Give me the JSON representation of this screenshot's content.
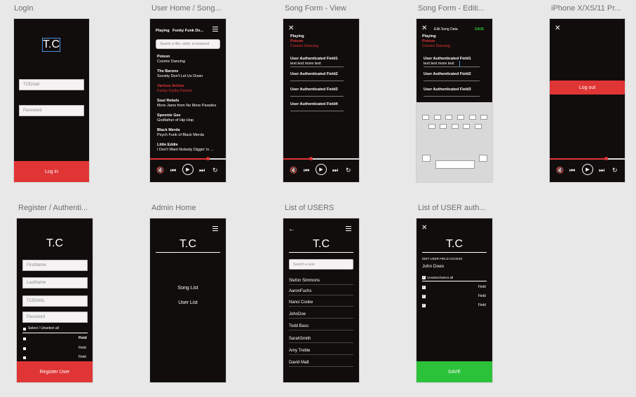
{
  "artboards": {
    "login": {
      "title": "LogIn",
      "logo": "T.C",
      "email_placeholder": "TCEmail",
      "password_placeholder": "Password",
      "login_button": "Log in"
    },
    "user_home": {
      "title": "User Home / Song...",
      "header_playing": "Playing",
      "header_song": "Funky Funk De...",
      "search_placeholder": "Search a title, artist, or keyword",
      "songs": [
        {
          "title": "Poison",
          "artist": "Cosmic Dancing",
          "highlight": false
        },
        {
          "title": "The Barons",
          "artist": "Society Don't Let Us Down",
          "highlight": false
        },
        {
          "title": "Various Artists",
          "artist": "Funky Funky Detroit",
          "highlight": true
        },
        {
          "title": "Soul Rebels",
          "artist": "More Jams from No More Parades",
          "highlight": false
        },
        {
          "title": "Spoonie Gee",
          "artist": "Godfather of Hip Hop",
          "highlight": false
        },
        {
          "title": "Black Merda",
          "artist": "Psych Funk of Black Merda",
          "highlight": false
        },
        {
          "title": "Little Eddie",
          "artist": "I Don't Want Nobody Diggin' in ...",
          "highlight": false
        }
      ],
      "progress": 0.76
    },
    "song_view": {
      "title": "Song Form - View",
      "playing": "Playing",
      "song": "Poison",
      "artist": "Cosmic Dancing",
      "field1": "User Authenticated Field1",
      "field1_value": "text text more text",
      "field2": "User Authenticated Field2",
      "field3": "User Authenticated Field3",
      "field4": "User Authenticated Field4",
      "progress": 0.36
    },
    "song_edit": {
      "title": "Song Form - Editi...",
      "header": "Edit Song Data",
      "save": "SAVE",
      "playing": "Playing",
      "song": "Poison",
      "artist": "Cosmic Dancing",
      "field1": "User Authenticated Field1",
      "field1_value": "text text more text",
      "field2": "User Authenticated Field2",
      "field3": "User Authenticated Field3"
    },
    "iphone": {
      "title": "iPhone X/XS/11 Pr...",
      "logout": "Log out",
      "progress": 0.75
    },
    "register": {
      "title": "Register / Authenti...",
      "logo": "T.C",
      "firstname": "FirstName",
      "lastname": "LastName",
      "email": "TCEMAIL",
      "password": "Password",
      "select_all": "Select / Unselect all",
      "field_label": "Field",
      "register_button": "Register User"
    },
    "admin_home": {
      "title": "Admin Home",
      "logo": "T.C",
      "song_list": "Song List",
      "user_list": "User List"
    },
    "list_users": {
      "title": "List of USERS",
      "logo": "T.C",
      "search_placeholder": "Search a user",
      "users": [
        "Stefon Simmons",
        "AaronFuchs",
        "Nanci Cooke",
        "JohnDoe",
        "Todd Bass",
        "SarahSmith",
        "Amy Treble",
        "David Matt"
      ]
    },
    "user_auth": {
      "title": "List of USER auth...",
      "logo": "T.C",
      "edit_label": "EDIT USER FIELD ACCESS",
      "user_name": "John Does",
      "select_all": "Unselect/Select all",
      "field_label": "Field",
      "save": "SAVE"
    }
  }
}
